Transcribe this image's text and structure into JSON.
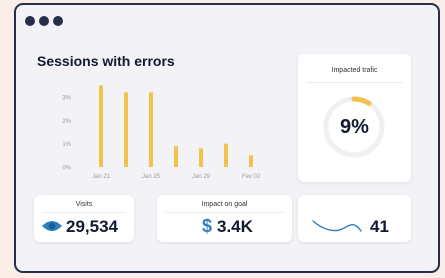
{
  "sessions": {
    "title": "Sessions with errors"
  },
  "chart_data": {
    "type": "bar",
    "title": "Sessions with errors",
    "y_ticks": [
      "0%",
      "1%",
      "2%",
      "3%"
    ],
    "ylim": [
      0,
      3.6
    ],
    "x_ticks": [
      {
        "label": "Jan 21",
        "bar": 0
      },
      {
        "label": "Jan 25",
        "bar": 2
      },
      {
        "label": "Jan 29",
        "bar": 4
      },
      {
        "label": "Fev 02",
        "bar": 6
      }
    ],
    "values": [
      3.5,
      3.2,
      3.2,
      0.9,
      0.8,
      1.0,
      0.5
    ],
    "bar_color": "#f2c14e",
    "grid": false
  },
  "impacted": {
    "title": "Impacted trafic",
    "value": "9%",
    "fraction": 0.09,
    "accent": "#f2c14e"
  },
  "visits": {
    "title": "Visits",
    "value": "29,534",
    "icon": "eye-icon",
    "icon_color": "#2f7fc1"
  },
  "goal": {
    "title": "Impact on goal",
    "currency": "$",
    "value": "3.4K"
  },
  "trend": {
    "value": "41",
    "icon": "trend-line-icon",
    "line_color": "#2f7fc1"
  }
}
